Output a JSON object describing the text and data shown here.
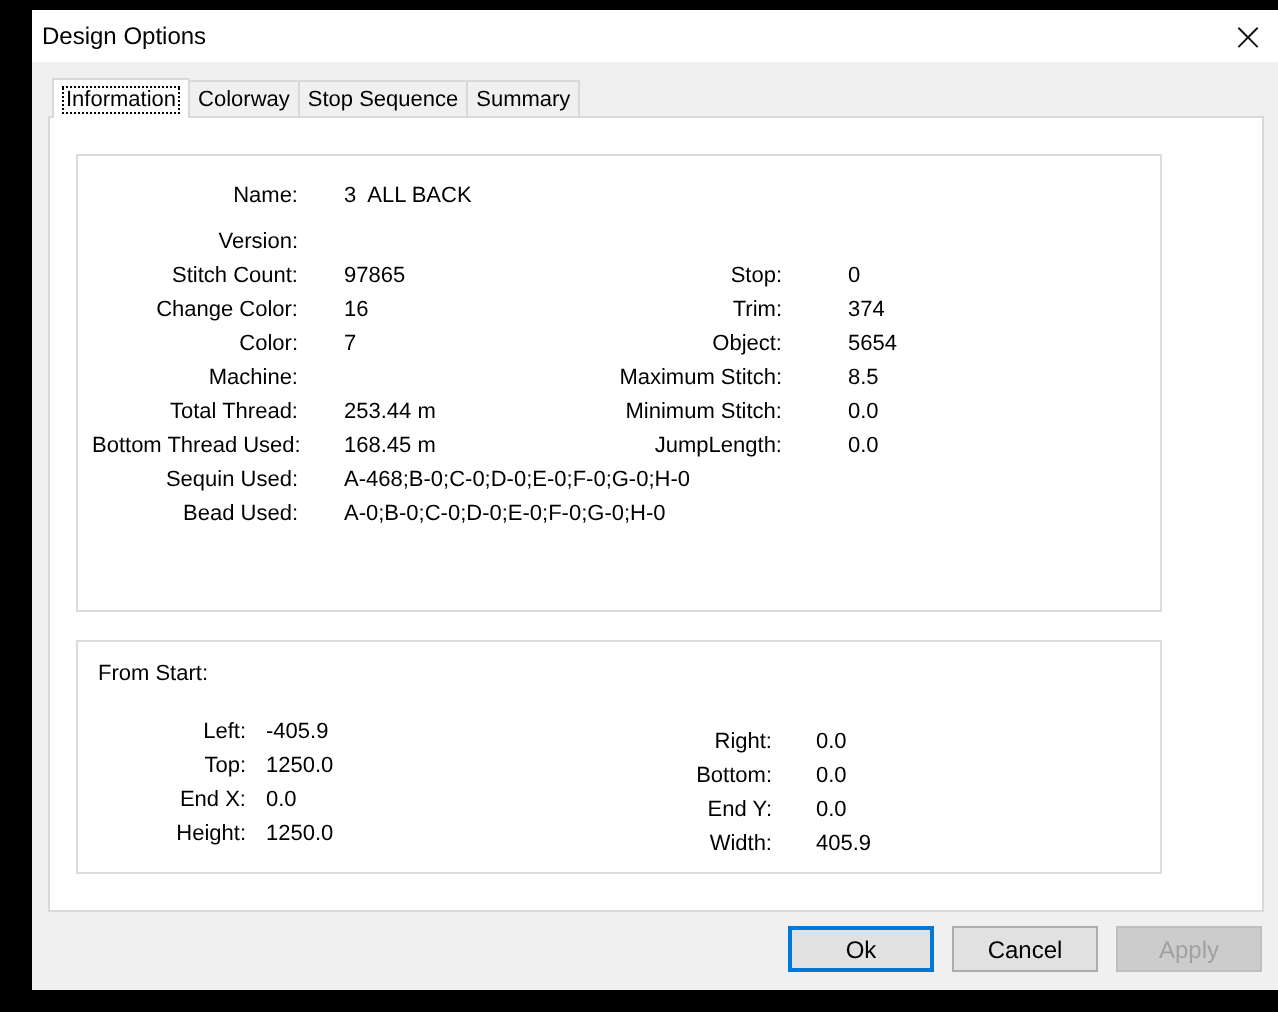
{
  "window": {
    "title": "Design Options",
    "close": "×"
  },
  "tabs": [
    {
      "label": "Information",
      "selected": true
    },
    {
      "label": "Colorway",
      "selected": false
    },
    {
      "label": "Stop Sequence",
      "selected": false
    },
    {
      "label": "Summary",
      "selected": false
    }
  ],
  "info": {
    "rows": [
      {
        "left": {
          "label": "Name:",
          "value": "3  ALL BACK"
        }
      },
      {
        "left": {
          "label": "Version:"
        }
      },
      {
        "left": {
          "label": "Stitch Count:",
          "value": "97865"
        },
        "right": {
          "label": "Stop:",
          "value": "0"
        }
      },
      {
        "left": {
          "label": "Change Color:",
          "value": "16"
        },
        "right": {
          "label": "Trim:",
          "value": "374"
        }
      },
      {
        "left": {
          "label": "Color:",
          "value": "7"
        },
        "right": {
          "label": "Object:",
          "value": "5654"
        }
      },
      {
        "left": {
          "label": "Machine:"
        },
        "right": {
          "label": "Maximum Stitch:",
          "value": "8.5"
        }
      },
      {
        "left": {
          "label": "Total Thread:",
          "value": "253.44 m"
        },
        "right": {
          "label": "Minimum Stitch:",
          "value": "0.0"
        }
      },
      {
        "left": {
          "label": "Bottom Thread Used:",
          "value": "168.45 m"
        },
        "right": {
          "label": "JumpLength:",
          "value": "0.0"
        }
      },
      {
        "left": {
          "label": "Sequin Used:",
          "value": "A-468;B-0;C-0;D-0;E-0;F-0;G-0;H-0"
        }
      },
      {
        "left": {
          "label": "Bead Used:",
          "value": "A-0;B-0;C-0;D-0;E-0;F-0;G-0;H-0"
        }
      }
    ]
  },
  "from_start": {
    "title": "From Start:",
    "left": [
      {
        "label": "Left:",
        "value": "-405.9"
      },
      {
        "label": "Top:",
        "value": "1250.0"
      },
      {
        "label": "End X:",
        "value": "0.0"
      },
      {
        "label": "Height:",
        "value": "1250.0"
      }
    ],
    "right": [
      {
        "label": "Right:",
        "value": "0.0"
      },
      {
        "label": "Bottom:",
        "value": "0.0"
      },
      {
        "label": "End Y:",
        "value": "0.0"
      },
      {
        "label": "Width:",
        "value": "405.9"
      }
    ]
  },
  "buttons": [
    {
      "label": "Ok",
      "default": true,
      "disabled": false
    },
    {
      "label": "Cancel",
      "default": false,
      "disabled": false
    },
    {
      "label": "Apply",
      "default": false,
      "disabled": true
    }
  ]
}
